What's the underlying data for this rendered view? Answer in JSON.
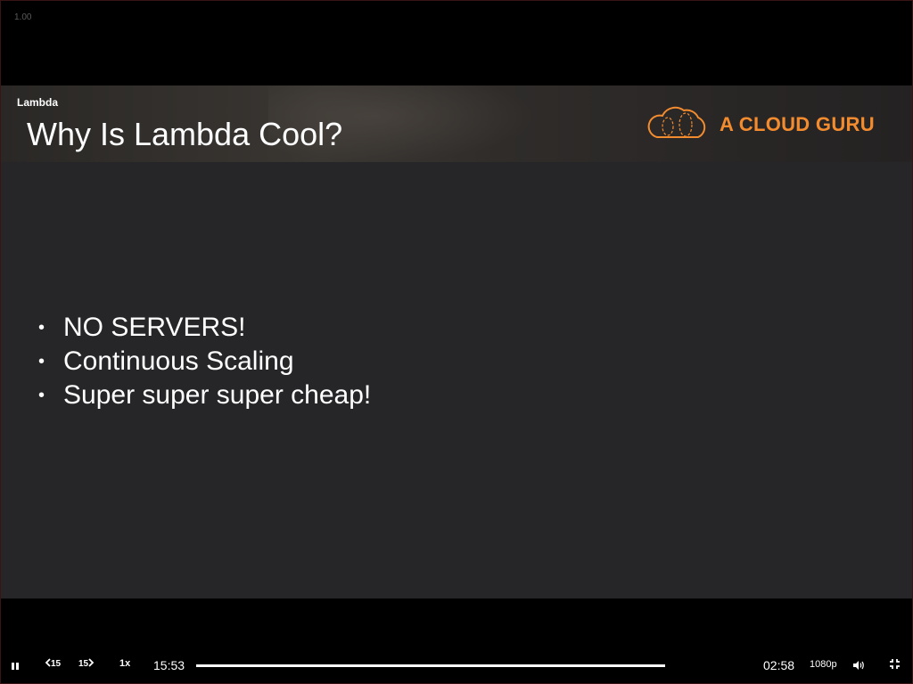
{
  "player": {
    "zoom_label": "1.00"
  },
  "slide": {
    "course_label": "Lambda",
    "title": "Why Is Lambda Cool?",
    "brand_name": "A CLOUD GURU",
    "brand_color": "#f38b2f",
    "bullets": [
      "NO SERVERS!",
      "Continuous Scaling",
      "Super super super cheap!"
    ]
  },
  "controls": {
    "play_state_icon": "pause-icon",
    "rewind_label": "15",
    "forward_label": "15",
    "speed_label": "1x",
    "elapsed_time": "15:53",
    "progress_fraction": 1.0,
    "remaining_time": "02:58",
    "quality_label": "1080p",
    "volume_icon": "volume-icon",
    "fullscreen_icon": "exit-fullscreen-icon"
  }
}
